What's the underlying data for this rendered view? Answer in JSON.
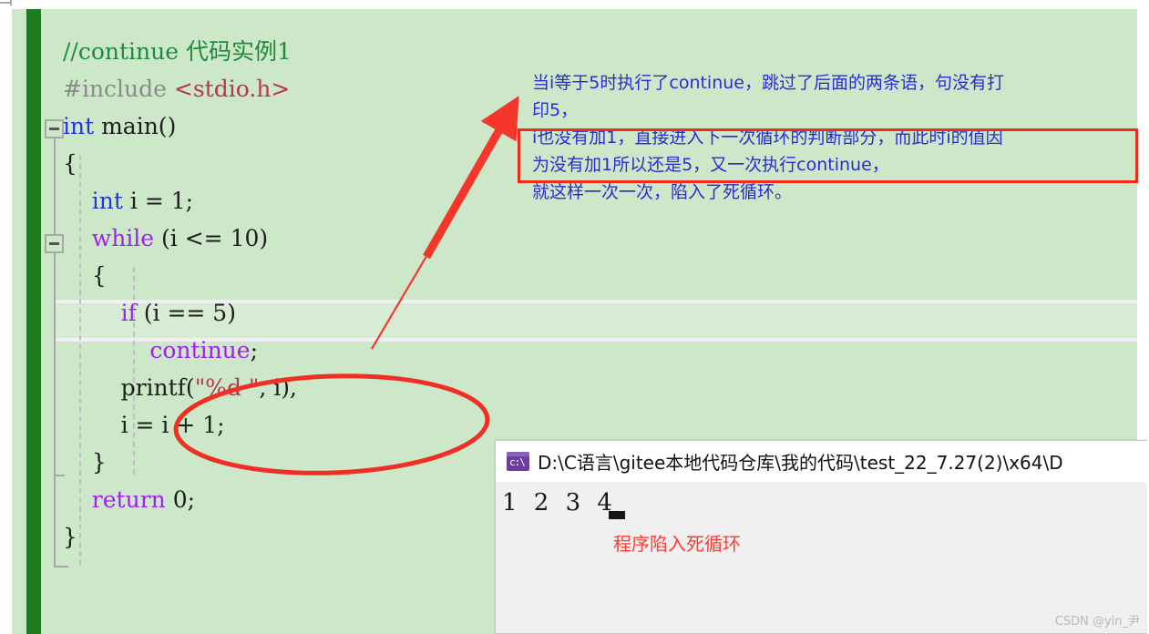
{
  "editor": {
    "name": "visual-studio-code-editor",
    "background_color": "#cde8c9",
    "change_bar_color": "#1b7d1b",
    "code_lines": [
      {
        "indent": 0,
        "tokens": [
          {
            "text": "//continue 代码实例1",
            "cls": "cmt"
          }
        ]
      },
      {
        "indent": 0,
        "tokens": [
          {
            "text": "#include ",
            "cls": "pp"
          },
          {
            "text": "<stdio.h>",
            "cls": "hdr"
          }
        ]
      },
      {
        "indent": 0,
        "tokens": [
          {
            "text": "int",
            "cls": "kw"
          },
          {
            "text": " main()",
            "cls": "plain"
          }
        ]
      },
      {
        "indent": 0,
        "tokens": [
          {
            "text": "{",
            "cls": "plain"
          }
        ]
      },
      {
        "indent": 0,
        "tokens": [
          {
            "text": "    ",
            "cls": "plain"
          },
          {
            "text": "int",
            "cls": "kw"
          },
          {
            "text": " i = 1;",
            "cls": "plain"
          }
        ]
      },
      {
        "indent": 0,
        "tokens": [
          {
            "text": "    ",
            "cls": "plain"
          },
          {
            "text": "while",
            "cls": "kw2"
          },
          {
            "text": " (i <= 10)",
            "cls": "plain"
          }
        ]
      },
      {
        "indent": 0,
        "tokens": [
          {
            "text": "    {",
            "cls": "plain"
          }
        ]
      },
      {
        "indent": 0,
        "tokens": [
          {
            "text": "        ",
            "cls": "plain"
          },
          {
            "text": "if",
            "cls": "kw2"
          },
          {
            "text": " (i == 5)",
            "cls": "plain"
          }
        ]
      },
      {
        "indent": 0,
        "tokens": [
          {
            "text": "            ",
            "cls": "plain"
          },
          {
            "text": "continue",
            "cls": "kw2"
          },
          {
            "text": ";",
            "cls": "plain"
          }
        ]
      },
      {
        "indent": 0,
        "tokens": [
          {
            "text": "        printf(",
            "cls": "plain"
          },
          {
            "text": "\"%d \"",
            "cls": "str"
          },
          {
            "text": ", i),",
            "cls": "plain"
          }
        ]
      },
      {
        "indent": 0,
        "tokens": [
          {
            "text": "        i = i + 1;",
            "cls": "plain"
          }
        ]
      },
      {
        "indent": 0,
        "tokens": [
          {
            "text": "    }",
            "cls": "plain"
          }
        ]
      },
      {
        "indent": 0,
        "tokens": [
          {
            "text": "    ",
            "cls": "plain"
          },
          {
            "text": "return",
            "cls": "kw2"
          },
          {
            "text": " 0;",
            "cls": "plain"
          }
        ]
      },
      {
        "indent": 0,
        "tokens": [
          {
            "text": "}",
            "cls": "plain"
          }
        ]
      }
    ]
  },
  "annotation": {
    "color": "#2b2bd4",
    "box_color": "#f42a1b",
    "lines": [
      "当i等于5时执行了continue，跳过了后面的两条语，句没有打",
      "印5，",
      "i也没有加1，直接进入下一次循环的判断部分，而此时i的值因",
      "为没有加1所以还是5，又一次执行continue，",
      "就这样一次一次，陷入了死循环。"
    ]
  },
  "console": {
    "title": "D:\\C语言\\gitee本地代码仓库\\我的代码\\test_22_7.27(2)\\x64\\D",
    "icon_glyph": "c:\\",
    "output": "1 2 3 4",
    "note": "程序陷入死循环",
    "note_color": "#ff3b30"
  },
  "watermark": {
    "text": "CSDN @yin_尹"
  }
}
